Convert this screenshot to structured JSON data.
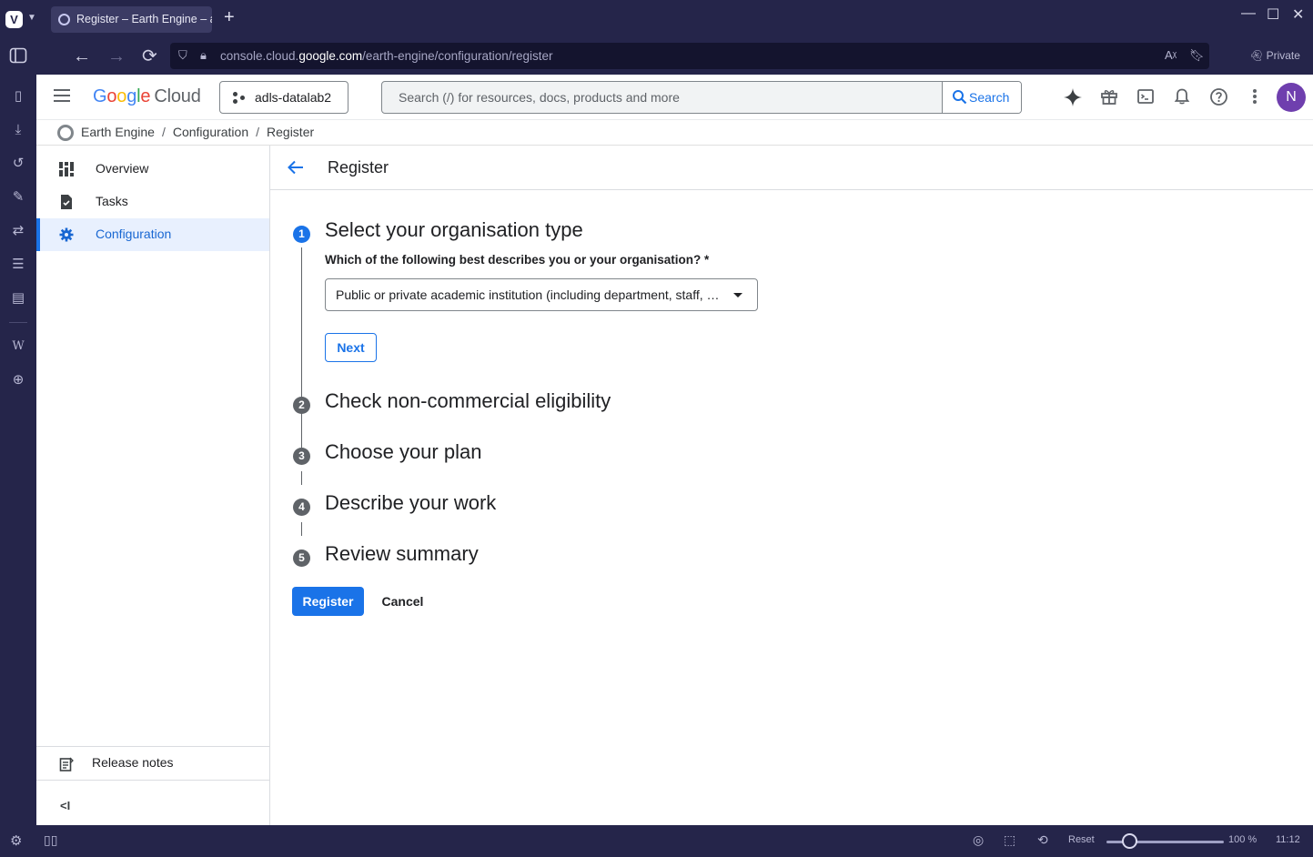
{
  "browser": {
    "tab_title": "Register – Earth Engine – a",
    "url_prefix": "console.cloud.",
    "url_host": "google.com",
    "url_path": "/earth-engine/configuration/register",
    "private_label": "Private",
    "status": {
      "reset_label": "Reset",
      "zoom": "100 %",
      "clock": "11:12"
    },
    "panel_icons": [
      "bookmarks-icon",
      "downloads-icon",
      "history-icon",
      "notes-icon",
      "translate-icon",
      "reading-list-icon",
      "window-icon",
      "wikipedia-icon",
      "add-panel-icon"
    ]
  },
  "header": {
    "logo": {
      "g1": "G",
      "o1": "o",
      "o2": "o",
      "g2": "g",
      "l": "l",
      "e": "e",
      "cloud": "Cloud"
    },
    "project": "adls-datalab2",
    "search_placeholder": "Search (/) for resources, docs, products and more",
    "search_button": "Search",
    "avatar_letter": "N"
  },
  "breadcrumb": {
    "items": [
      "Earth Engine",
      "Configuration",
      "Register"
    ],
    "separator": "/"
  },
  "sidebar": {
    "items": [
      {
        "label": "Overview",
        "icon": "dashboard-icon"
      },
      {
        "label": "Tasks",
        "icon": "tasks-icon"
      },
      {
        "label": "Configuration",
        "icon": "gear-icon",
        "active": true
      }
    ],
    "release_notes": "Release notes",
    "collapse_label": "<I"
  },
  "main": {
    "title": "Register",
    "steps": [
      {
        "number": "1",
        "title": "Select your organisation type",
        "active": true
      },
      {
        "number": "2",
        "title": "Check non-commercial eligibility"
      },
      {
        "number": "3",
        "title": "Choose your plan"
      },
      {
        "number": "4",
        "title": "Describe your work"
      },
      {
        "number": "5",
        "title": "Review summary"
      }
    ],
    "question": "Which of the following best describes you or your organisation? *",
    "selected_option": "Public or private academic institution (including department, staff, …",
    "next_button": "Next",
    "register_button": "Register",
    "cancel_button": "Cancel"
  },
  "colors": {
    "accent": "#1a73e8",
    "browser_chrome": "#25254a",
    "avatar": "#6f3fae"
  }
}
